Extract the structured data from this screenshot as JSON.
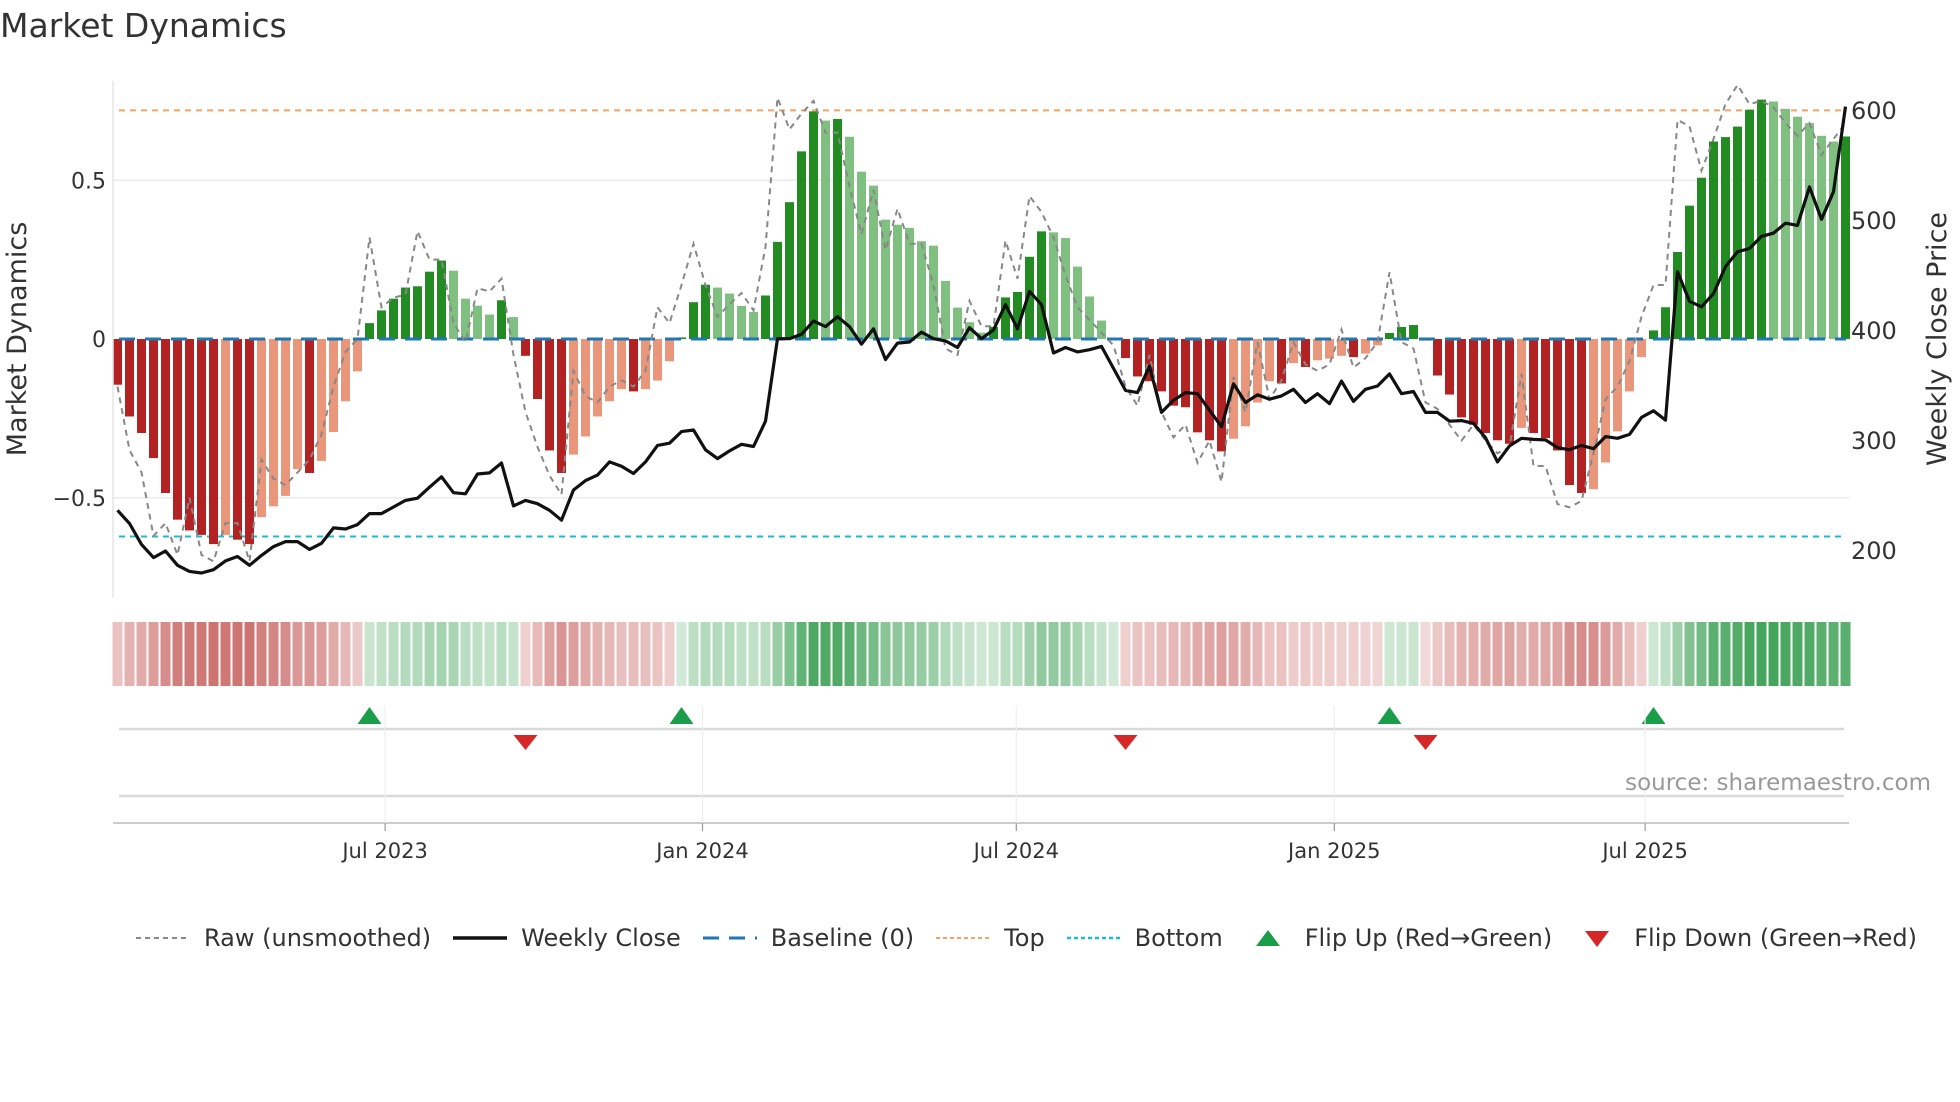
{
  "title": "Market Dynamics",
  "source": "source: sharemaestro.com",
  "colors": {
    "strong_red": "#b22222",
    "weak_red": "#e9967a",
    "strong_green": "#228b22",
    "weak_green": "#7fbf7f",
    "close": "#111111",
    "raw": "#888888",
    "baseline": "#1f77b4",
    "top": "#f4a460",
    "bottom": "#17becf",
    "flip_up": "#1a9e4a",
    "flip_down": "#d62728"
  },
  "legend": [
    {
      "key": "raw",
      "label": "Raw (unsmoothed)"
    },
    {
      "key": "close",
      "label": "Weekly Close"
    },
    {
      "key": "baseline",
      "label": "Baseline (0)"
    },
    {
      "key": "top",
      "label": "Top"
    },
    {
      "key": "bottom",
      "label": "Bottom"
    },
    {
      "key": "flip_up",
      "label": "Flip Up (Red→Green)"
    },
    {
      "key": "flip_down",
      "label": "Flip Down (Green→Red)"
    }
  ],
  "chart_data": {
    "type": "bar",
    "title": "Market Dynamics",
    "ylabel": "Market Dynamics",
    "y2label": "Weekly Close Price",
    "ylim": [
      -0.82,
      0.84
    ],
    "y2lim": [
      153,
      643
    ],
    "y_ticks": [
      {
        "value": 0.5,
        "label": "0.5"
      },
      {
        "value": 0,
        "label": "0"
      },
      {
        "value": -0.5,
        "label": "−0.5"
      }
    ],
    "y2_ticks": [
      {
        "value": 600,
        "label": "600"
      },
      {
        "value": 500,
        "label": "500"
      },
      {
        "value": 400,
        "label": "400"
      },
      {
        "value": 300,
        "label": "300"
      },
      {
        "value": 200,
        "label": "200"
      }
    ],
    "x_ticks": [
      {
        "week": 22.3,
        "label": "Jul 2023"
      },
      {
        "week": 48.75,
        "label": "Jan 2024"
      },
      {
        "week": 74.9,
        "label": "Jul 2024"
      },
      {
        "week": 101.4,
        "label": "Jan 2025"
      },
      {
        "week": 127.3,
        "label": "Jul 2025"
      }
    ],
    "top_level": 0.72,
    "bottom_level": -0.622,
    "baseline": 0,
    "values": [
      -0.144,
      -0.244,
      -0.296,
      -0.375,
      -0.485,
      -0.569,
      -0.603,
      -0.617,
      -0.646,
      -0.617,
      -0.632,
      -0.646,
      -0.561,
      -0.527,
      -0.494,
      -0.41,
      -0.422,
      -0.384,
      -0.293,
      -0.196,
      -0.102,
      0.05,
      0.09,
      0.127,
      0.162,
      0.166,
      0.212,
      0.247,
      0.215,
      0.127,
      0.105,
      0.077,
      0.122,
      0.069,
      -0.053,
      -0.189,
      -0.351,
      -0.422,
      -0.364,
      -0.307,
      -0.244,
      -0.196,
      -0.158,
      -0.165,
      -0.158,
      -0.131,
      -0.07,
      0.005,
      0.116,
      0.171,
      0.162,
      0.143,
      0.104,
      0.085,
      0.137,
      0.306,
      0.431,
      0.591,
      0.717,
      0.688,
      0.693,
      0.637,
      0.527,
      0.483,
      0.376,
      0.36,
      0.35,
      0.308,
      0.294,
      0.183,
      0.099,
      0.053,
      0.02,
      0.038,
      0.131,
      0.148,
      0.259,
      0.339,
      0.336,
      0.318,
      0.228,
      0.134,
      0.058,
      0.004,
      -0.06,
      -0.118,
      -0.133,
      -0.165,
      -0.21,
      -0.215,
      -0.294,
      -0.319,
      -0.354,
      -0.314,
      -0.275,
      -0.2,
      -0.133,
      -0.14,
      -0.076,
      -0.088,
      -0.067,
      -0.062,
      -0.053,
      -0.057,
      -0.046,
      -0.02,
      0.019,
      0.038,
      0.044,
      -0.005,
      -0.115,
      -0.175,
      -0.247,
      -0.27,
      -0.296,
      -0.319,
      -0.33,
      -0.28,
      -0.296,
      -0.312,
      -0.351,
      -0.46,
      -0.485,
      -0.473,
      -0.389,
      -0.291,
      -0.165,
      -0.057,
      0.027,
      0.1,
      0.274,
      0.42,
      0.508,
      0.622,
      0.636,
      0.669,
      0.722,
      0.754,
      0.748,
      0.725,
      0.7,
      0.68,
      0.64,
      0.622,
      0.638
    ],
    "raw": [
      -0.15,
      -0.35,
      -0.42,
      -0.62,
      -0.58,
      -0.68,
      -0.5,
      -0.68,
      -0.7,
      -0.58,
      -0.58,
      -0.7,
      -0.38,
      -0.44,
      -0.46,
      -0.42,
      -0.38,
      -0.3,
      -0.15,
      -0.04,
      0.0,
      0.32,
      0.1,
      0.13,
      0.14,
      0.34,
      0.25,
      0.25,
      0.05,
      -0.01,
      0.16,
      0.15,
      0.19,
      -0.05,
      -0.23,
      -0.34,
      -0.43,
      -0.49,
      -0.1,
      -0.18,
      -0.2,
      -0.15,
      -0.13,
      -0.15,
      -0.1,
      0.1,
      0.05,
      0.17,
      0.3,
      0.17,
      0.07,
      0.11,
      0.145,
      0.09,
      0.29,
      0.76,
      0.66,
      0.71,
      0.75,
      0.65,
      0.65,
      0.48,
      0.33,
      0.47,
      0.28,
      0.41,
      0.3,
      0.3,
      0.17,
      -0.03,
      -0.05,
      0.12,
      0.04,
      0.04,
      0.31,
      0.19,
      0.45,
      0.4,
      0.32,
      0.2,
      0.1,
      0.06,
      0.02,
      -0.02,
      -0.15,
      -0.21,
      -0.05,
      -0.23,
      -0.31,
      -0.27,
      -0.39,
      -0.32,
      -0.45,
      -0.12,
      -0.23,
      -0.01,
      -0.19,
      -0.13,
      -0.01,
      -0.08,
      -0.1,
      -0.08,
      0.03,
      -0.09,
      -0.06,
      -0.01,
      0.21,
      -0.01,
      -0.03,
      -0.2,
      -0.22,
      -0.27,
      -0.32,
      -0.27,
      -0.32,
      -0.36,
      -0.34,
      -0.11,
      -0.4,
      -0.4,
      -0.52,
      -0.53,
      -0.51,
      -0.36,
      -0.19,
      -0.15,
      -0.07,
      0.07,
      0.17,
      0.17,
      0.69,
      0.67,
      0.53,
      0.63,
      0.74,
      0.8,
      0.74,
      0.75,
      0.73,
      0.68,
      0.64,
      0.68,
      0.58,
      0.63,
      0.68
    ],
    "close": [
      237,
      225,
      206,
      194,
      200,
      187,
      181.5,
      180,
      183,
      191,
      195,
      187,
      196,
      204,
      208.5,
      208.5,
      201.5,
      207,
      221,
      220,
      224,
      234,
      234,
      240,
      246,
      248,
      258,
      267.5,
      253,
      252,
      270,
      271,
      280,
      241,
      246,
      243,
      237,
      228,
      255.5,
      264,
      269,
      281,
      277,
      270.5,
      281,
      296,
      298,
      308.5,
      310,
      292,
      284,
      291,
      297,
      295,
      318,
      393,
      393,
      397,
      409,
      404,
      413,
      404,
      388,
      402,
      374,
      389,
      390,
      399,
      393,
      391,
      385,
      403,
      393,
      401,
      424,
      402,
      436,
      424,
      380,
      385,
      381,
      383,
      386,
      366,
      346,
      344,
      368,
      326,
      337,
      344,
      343,
      328,
      313,
      352,
      335,
      342,
      338,
      341,
      347,
      335,
      343,
      334,
      354.5,
      336,
      347,
      350,
      361,
      343,
      345,
      326,
      326,
      318,
      318.5,
      316,
      303,
      281,
      295.5,
      302.5,
      301.5,
      301,
      294,
      292,
      296,
      293,
      304,
      302.5,
      306,
      321.5,
      327.5,
      319,
      454,
      427,
      422,
      434,
      458.5,
      472,
      475,
      486,
      489,
      498,
      496,
      531,
      501.5,
      526.6,
      604
    ],
    "flip_up_weeks": [
      21,
      47,
      106,
      128
    ],
    "flip_down_weeks": [
      34,
      84,
      109
    ],
    "grid": true,
    "legend_position": "bottom"
  }
}
